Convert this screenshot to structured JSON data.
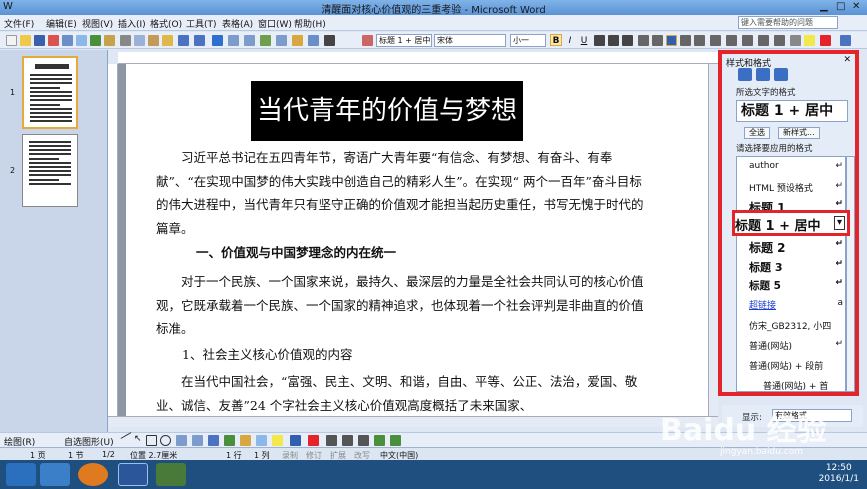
{
  "window": {
    "title": "清醒面对核心价值观的三重考验 - Microsoft Word"
  },
  "menu": [
    "文件(F)",
    "编辑(E)",
    "视图(V)",
    "插入(I)",
    "格式(O)",
    "工具(T)",
    "表格(A)",
    "窗口(W)",
    "帮助(H)"
  ],
  "help_placeholder": "键入需要帮助的问题",
  "toolbar": {
    "style_combo": "标题 1 + 居中",
    "font_combo": "宋体",
    "size_combo": "小一",
    "bold": "B",
    "italic": "I",
    "underline": "U"
  },
  "thumbnails": [
    {
      "page": "1"
    },
    {
      "page": "2"
    }
  ],
  "document": {
    "title": "当代青年的价值与梦想",
    "para1": "习近平总书记在五四青年节，寄语广大青年要“有信念、有梦想、有奋斗、有奉献”、“在实现中国梦的伟大实践中创造自己的精彩人生”。在实现“ 两个一百年”奋斗目标的伟大进程中，当代青年只有坚守正确的价值观才能担当起历史重任，书写无愧于时代的篇章。",
    "heading1": "一、价值观与中国梦理念的内在统一",
    "para2": "对于一个民族、一个国家来说，最持久、最深层的力量是全社会共同认可的核心价值观，它既承载着一个民族、一个国家的精神追求，也体现着一个社会评判是非曲直的价值标准。",
    "subheading1": "1、社会主义核心价值观的内容",
    "para3": "在当代中国社会，“富强、民主、文明、和谐，自由、平等、公正、法治，爱国、敬业、诚信、友善”24 个字社会主义核心价值观高度概括了未来国家、"
  },
  "panel": {
    "title": "样式和格式",
    "selected_label": "所选文字的格式",
    "selected_format": "标题 1 + 居中",
    "select_all": "全选",
    "new_style": "新样式...",
    "apply_label": "请选择要应用的格式",
    "styles": [
      {
        "name": "author",
        "cls": "small"
      },
      {
        "name": "HTML 预设格式",
        "cls": "small"
      },
      {
        "name": "标题 1",
        "cls": "h1"
      },
      {
        "name": "标题 1 + 居中",
        "cls": "h1sel"
      },
      {
        "name": "标题 2",
        "cls": "h2"
      },
      {
        "name": "标题 3",
        "cls": "h3"
      },
      {
        "name": "标题 5",
        "cls": "h3"
      },
      {
        "name": "超链接",
        "cls": "link"
      },
      {
        "name": "仿宋_GB2312, 小四",
        "cls": "small"
      },
      {
        "name": "普通(网站)",
        "cls": "small"
      },
      {
        "name": "普通(网站) + 段前",
        "cls": "small"
      },
      {
        "name": "普通(网站) + 首",
        "cls": "small2"
      }
    ],
    "show_label": "显示:",
    "show_value": "有效格式"
  },
  "drawbar": {
    "draw": "绘图(R)",
    "autoshape": "自选图形(U)"
  },
  "status": {
    "page": "1 页",
    "section": "1 节",
    "pos": "1/2",
    "at": "位置 2.7厘米",
    "line": "1 行",
    "col": "1 列",
    "rec": "录制",
    "trk": "修订",
    "ext": "扩展",
    "ovr": "改写",
    "lang": "中文(中国)"
  },
  "clock": {
    "time": "12:50",
    "date": "2016/1/1"
  },
  "watermark": {
    "brand": "Baidu 经验",
    "url": "jingyan.baidu.com"
  },
  "colors": {
    "accent": "#e3242b",
    "blue": "#3a6fc4",
    "taskbar": "#1f4f7f"
  }
}
